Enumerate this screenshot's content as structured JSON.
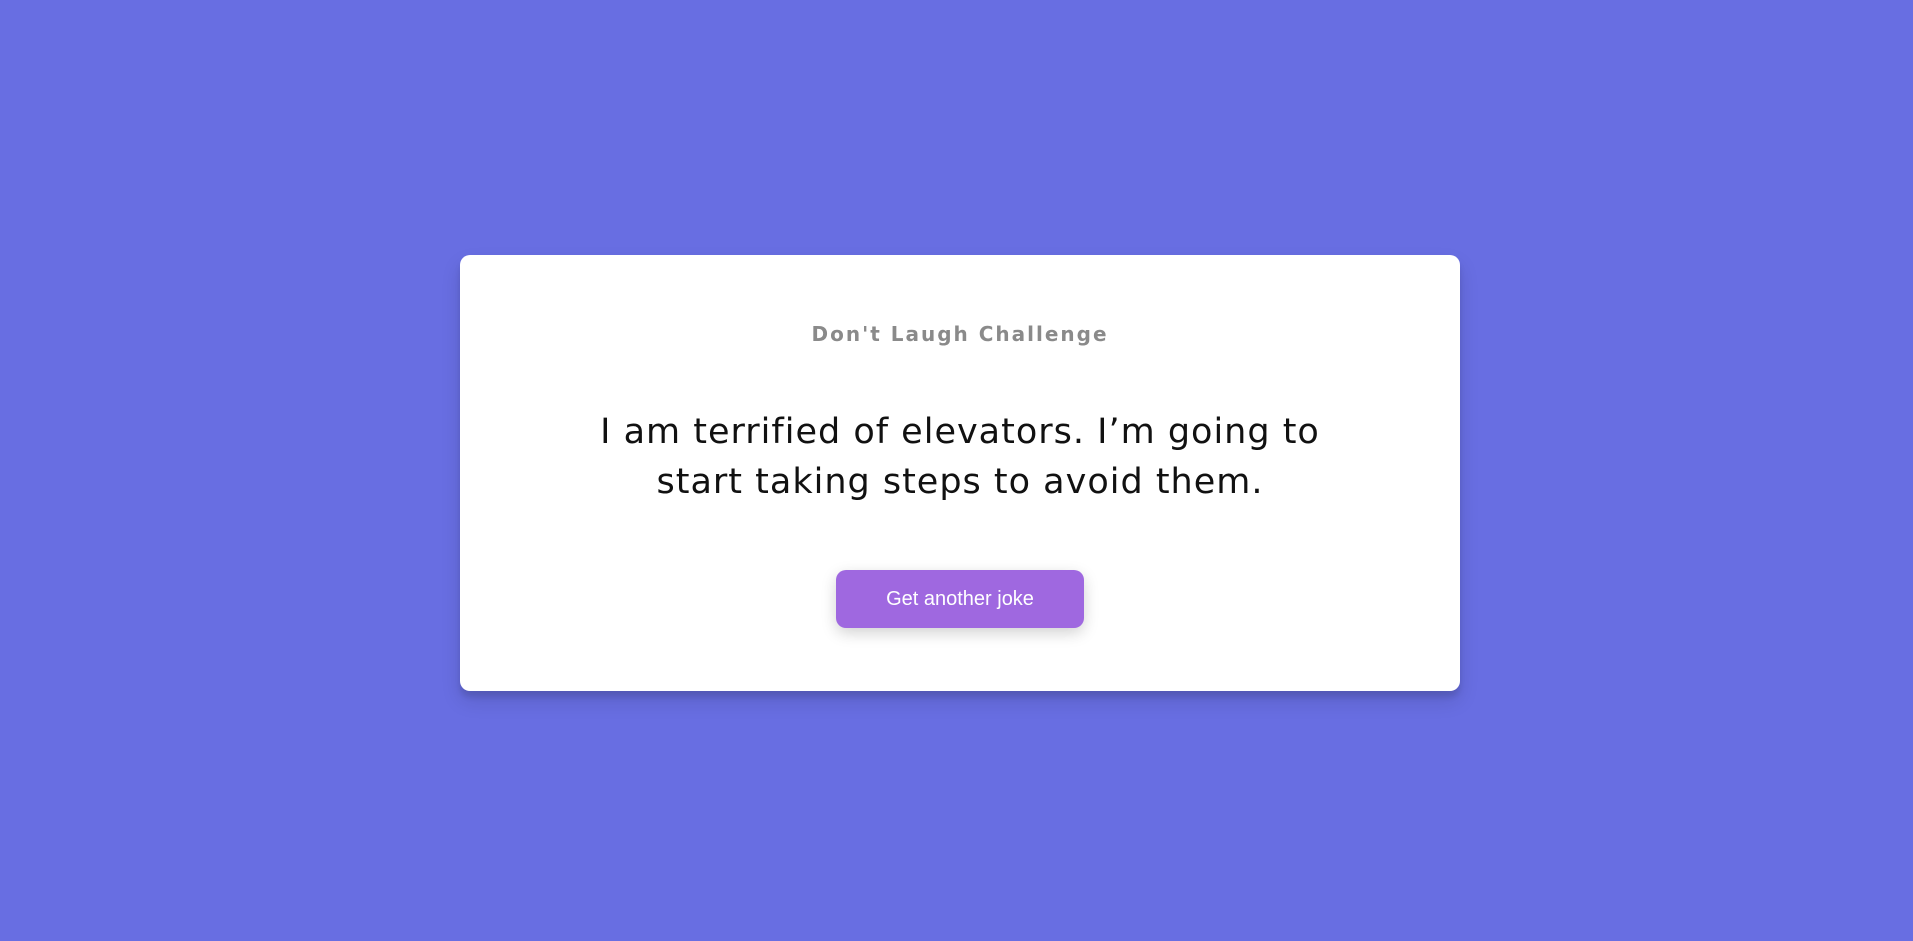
{
  "theme": {
    "background": "#686ee2",
    "card": "#ffffff",
    "accent": "#9f68e0",
    "title_color": "#8a8a8a",
    "text_color": "#111111"
  },
  "card": {
    "title": "Don't Laugh Challenge",
    "joke": "I am terrified of elevators. I’m going to start taking steps to avoid them.",
    "button_label": "Get another joke"
  }
}
